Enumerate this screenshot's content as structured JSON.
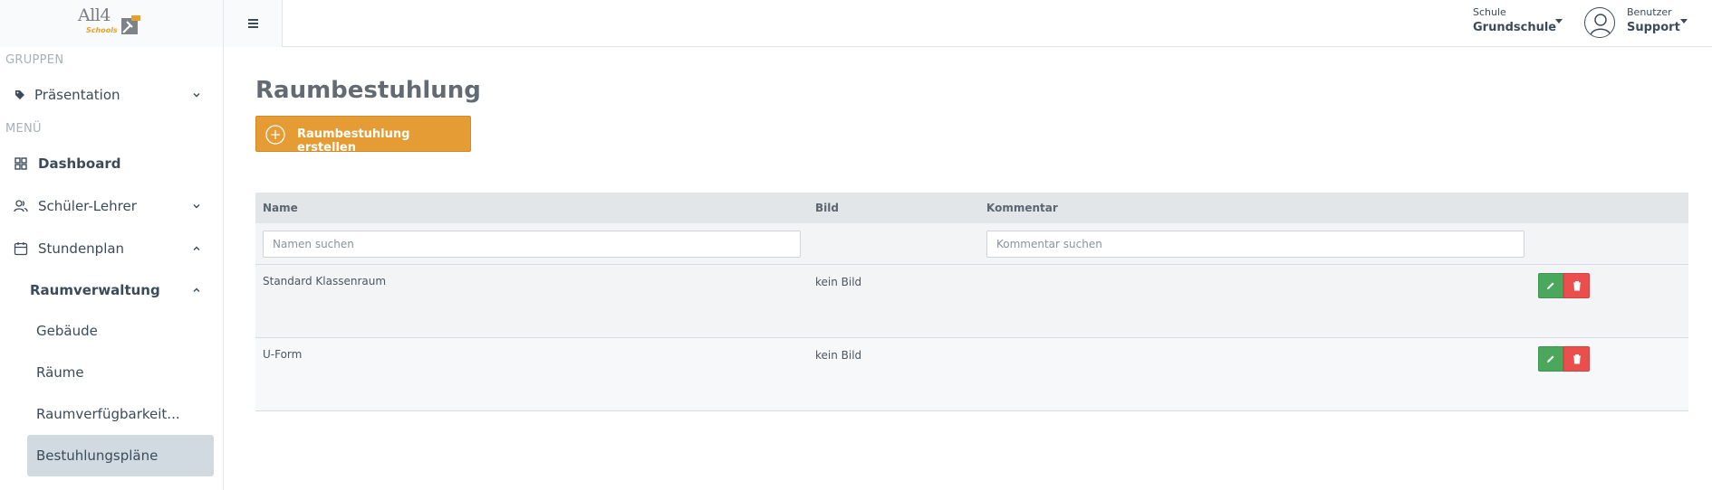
{
  "header": {
    "logo_text": "All4",
    "logo_sub": "Schools",
    "school_label": "Schule",
    "school_value": "Grundschule",
    "user_label": "Benutzer",
    "user_value": "Support"
  },
  "sidebar": {
    "group_gruppen": "GRUPPEN",
    "group_menu": "MENÜ",
    "items": [
      {
        "label": "Präsentation",
        "icon": "tag-icon"
      },
      {
        "label": "Dashboard",
        "icon": "dashboard-grid-icon"
      },
      {
        "label": "Schüler-Lehrer",
        "icon": "users-icon"
      },
      {
        "label": "Stundenplan",
        "icon": "calendar-icon"
      },
      {
        "label": "Raumverwaltung"
      },
      {
        "label": "Gebäude"
      },
      {
        "label": "Räume"
      },
      {
        "label": "Raumverfügbarkeit..."
      },
      {
        "label": "Bestuhlungspläne"
      }
    ]
  },
  "main": {
    "title": "Raumbestuhlung",
    "create_button": "Raumbestuhlung erstellen",
    "table": {
      "columns": [
        "Name",
        "Bild",
        "Kommentar"
      ],
      "filters": {
        "name_placeholder": "Namen suchen",
        "comment_placeholder": "Kommentar suchen"
      },
      "rows": [
        {
          "name": "Standard Klassenraum",
          "bild": "kein Bild",
          "kommentar": ""
        },
        {
          "name": "U-Form",
          "bild": "kein Bild",
          "kommentar": ""
        }
      ]
    }
  },
  "colors": {
    "accent_orange": "#e59c34",
    "edit_green": "#4aa75c",
    "delete_red": "#e94f4c",
    "active_nav_bg": "#d1dae1"
  }
}
